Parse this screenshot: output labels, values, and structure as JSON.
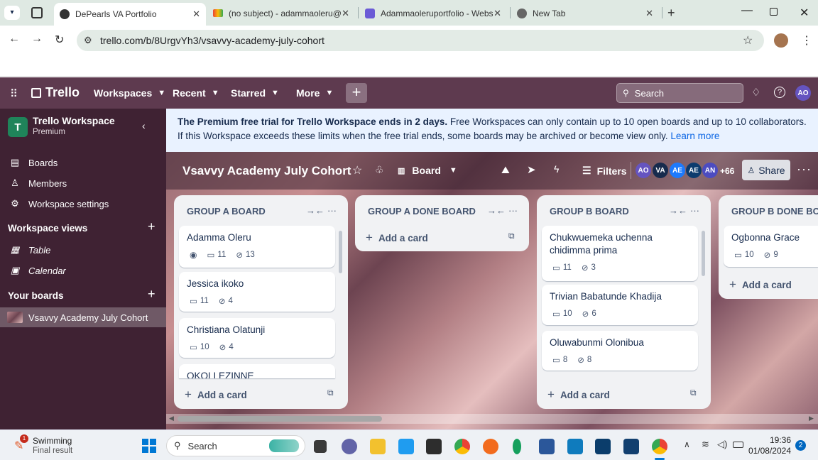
{
  "browser": {
    "tabs": [
      {
        "title": "DePearls VA Portfolio",
        "icon": "page-favicon"
      },
      {
        "title": "(no subject) - adammaoleru@g",
        "icon": "gmail-favicon"
      },
      {
        "title": "Adammaoleruportfolio - Websi",
        "icon": "sites-favicon"
      },
      {
        "title": "New Tab",
        "icon": "chrome-favicon"
      }
    ],
    "url": "trello.com/b/8UrgvYh3/vsavvy-academy-july-cohort"
  },
  "trello": {
    "logo": "Trello",
    "nav": {
      "workspaces": "Workspaces",
      "recent": "Recent",
      "starred": "Starred",
      "more": "More"
    },
    "search_placeholder": "Search",
    "user_initials": "AO"
  },
  "sidebar": {
    "workspace_letter": "T",
    "workspace_name": "Trello Workspace",
    "workspace_plan": "Premium",
    "items": [
      {
        "label": "Boards",
        "icon": "boards-icon"
      },
      {
        "label": "Members",
        "icon": "members-icon"
      },
      {
        "label": "Workspace settings",
        "icon": "settings-icon"
      }
    ],
    "views_header": "Workspace views",
    "views": [
      {
        "label": "Table",
        "icon": "table-icon"
      },
      {
        "label": "Calendar",
        "icon": "calendar-icon"
      }
    ],
    "boards_header": "Your boards",
    "boards": [
      {
        "label": "Vsavvy Academy July Cohort"
      }
    ]
  },
  "banner": {
    "bold": "The Premium free trial for Trello Workspace ends in 2 days.",
    "text": " Free Workspaces can only contain up to 10 open boards and up to 10 collaborators. If this Workspace exceeds these limits when the free trial ends, some boards may be archived or become view only. ",
    "link": "Learn more"
  },
  "board": {
    "title": "Vsavvy Academy July Cohort",
    "view": "Board",
    "filters": "Filters",
    "members": [
      "AO",
      "VA",
      "AE",
      "AE",
      "AN"
    ],
    "more_members": "+66",
    "share": "Share",
    "lists": [
      {
        "title": "GROUP A BOARD",
        "cards": [
          {
            "title": "Adamma Oleru",
            "comments": "11",
            "attachments": "13",
            "watch": true
          },
          {
            "title": "Jessica ikoko",
            "comments": "11",
            "attachments": "4"
          },
          {
            "title": "Christiana Olatunji",
            "comments": "10",
            "attachments": "4"
          },
          {
            "title": "OKOLI EZINNE"
          }
        ],
        "add": "Add a card"
      },
      {
        "title": "GROUP A DONE BOARD",
        "cards": [],
        "add": "Add a card"
      },
      {
        "title": "GROUP B BOARD",
        "cards": [
          {
            "title": "Chukwuemeka uchenna chidimma prima",
            "comments": "11",
            "attachments": "3"
          },
          {
            "title": "Trivian Babatunde Khadija",
            "comments": "10",
            "attachments": "6"
          },
          {
            "title": "Oluwabunmi Olonibua",
            "comments": "8",
            "attachments": "8"
          }
        ],
        "add": "Add a card"
      },
      {
        "title": "GROUP B DONE BOA",
        "cards": [
          {
            "title": "Ogbonna Grace",
            "comments": "10",
            "attachments": "9"
          }
        ],
        "add": "Add a card"
      }
    ]
  },
  "taskbar": {
    "weather_badge": "1",
    "weather_title": "Swimming",
    "weather_sub": "Final result",
    "search": "Search",
    "time": "19:36",
    "date": "01/08/2024",
    "notif": "2"
  },
  "colors": {
    "header": "#5e3a4f",
    "sidebar": "#3f2233",
    "banner": "#e9f2ff",
    "accent": "#0c66e4"
  }
}
